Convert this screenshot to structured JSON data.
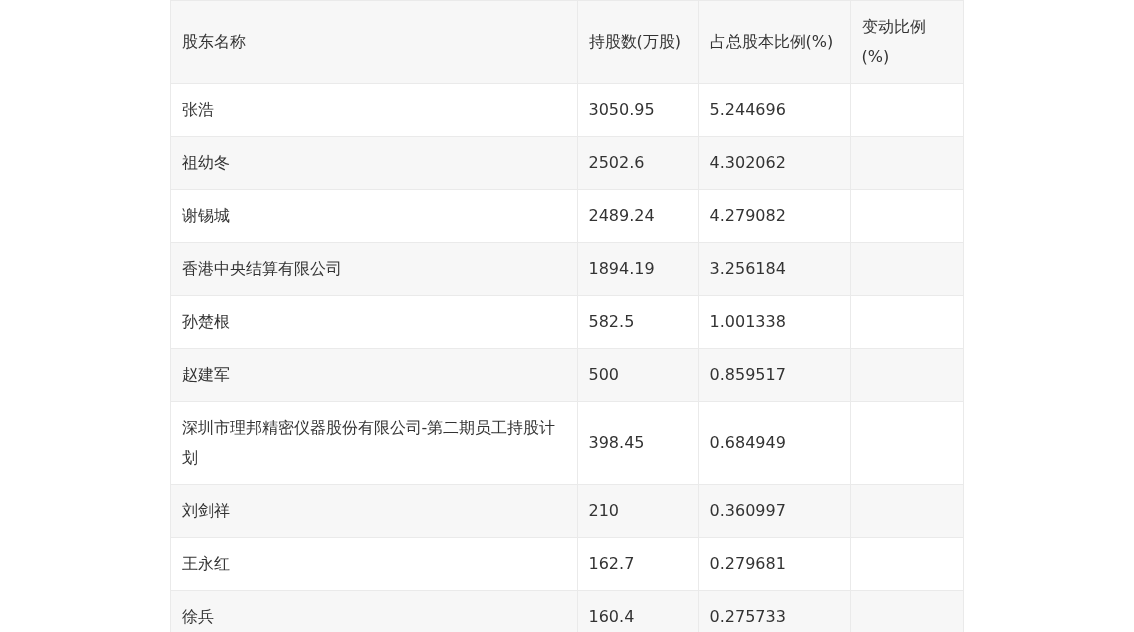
{
  "table": {
    "columns": [
      "股东名称",
      "持股数(万股)",
      "占总股本比例(%)",
      "变动比例(%)"
    ],
    "rows": [
      [
        "张浩",
        "3050.95",
        "5.244696"
      ],
      [
        "祖幼冬",
        "2502.6",
        "4.302062"
      ],
      [
        "谢锡城",
        "2489.24",
        "4.279082"
      ],
      [
        "香港中央结算有限公司",
        "1894.19",
        "3.256184"
      ],
      [
        "孙楚根",
        "582.5",
        "1.001338"
      ],
      [
        "赵建军",
        "500",
        "0.859517"
      ],
      [
        "深圳市理邦精密仪器股份有限公司-第二期员工持股计划",
        "398.45",
        "0.684949"
      ],
      [
        "刘剑祥",
        "210",
        "0.360997"
      ],
      [
        "王永红",
        "162.7",
        "0.279681"
      ],
      [
        "徐兵",
        "160.4",
        "0.275733"
      ]
    ]
  }
}
